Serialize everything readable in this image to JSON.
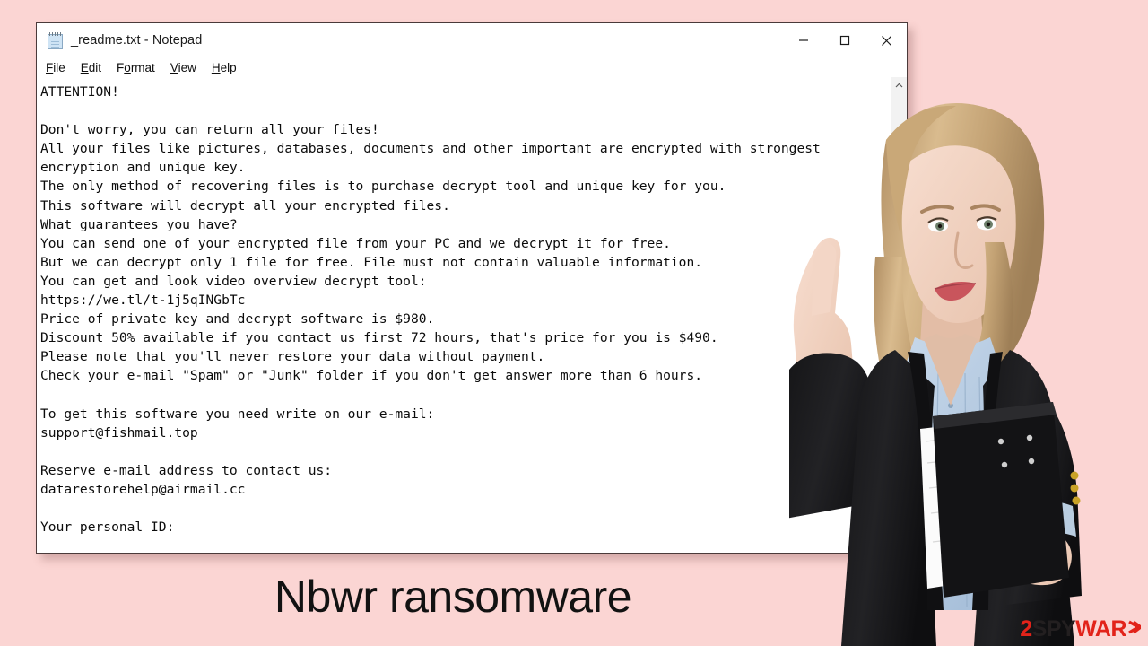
{
  "window": {
    "title": "_readme.txt - Notepad",
    "icon": "notepad-icon",
    "controls": {
      "minimize": "Minimize",
      "maximize": "Maximize",
      "close": "Close"
    },
    "menu": [
      {
        "label": "File",
        "accel": "F"
      },
      {
        "label": "Edit",
        "accel": "E"
      },
      {
        "label": "Format",
        "accel": "o"
      },
      {
        "label": "View",
        "accel": "V"
      },
      {
        "label": "Help",
        "accel": "H"
      }
    ],
    "scrollbar": {
      "up_arrow": "scroll-up-arrow",
      "down_arrow": "scroll-down-arrow"
    }
  },
  "note": {
    "body": "ATTENTION!\n\nDon't worry, you can return all your files!\nAll your files like pictures, databases, documents and other important are encrypted with strongest\nencryption and unique key.\nThe only method of recovering files is to purchase decrypt tool and unique key for you.\nThis software will decrypt all your encrypted files.\nWhat guarantees you have?\nYou can send one of your encrypted file from your PC and we decrypt it for free.\nBut we can decrypt only 1 file for free. File must not contain valuable information.\nYou can get and look video overview decrypt tool:\nhttps://we.tl/t-1j5qINGbTc\nPrice of private key and decrypt software is $980.\nDiscount 50% available if you contact us first 72 hours, that's price for you is $490.\nPlease note that you'll never restore your data without payment.\nCheck your e-mail \"Spam\" or \"Junk\" folder if you don't get answer more than 6 hours.\n\nTo get this software you need write on our e-mail:\nsupport@fishmail.top\n\nReserve e-mail address to contact us:\ndatarestorehelp@airmail.cc\n\nYour personal ID:",
    "details": {
      "video_url": "https://we.tl/t-1j5qINGbTc",
      "price": "$980",
      "discount_price": "$490",
      "discount_percent": "50%",
      "discount_window": "72 hours",
      "response_time": "6 hours",
      "primary_email": "support@fishmail.top",
      "reserve_email": "datarestorehelp@airmail.cc",
      "free_file_count": "1"
    }
  },
  "caption": {
    "text": "Nbwr ransomware"
  },
  "watermark": {
    "part1": "2",
    "part2": "SPY",
    "part3": "WAR",
    "part4": "E"
  },
  "photo": {
    "alt": "woman-pointing-up-holding-folder"
  },
  "colors": {
    "background": "#fbd5d3",
    "window_bg": "#ffffff",
    "window_border": "#4a3a3a",
    "text": "#0c0c0c",
    "brand_red": "#e2231a",
    "brand_dark": "#231f20"
  }
}
